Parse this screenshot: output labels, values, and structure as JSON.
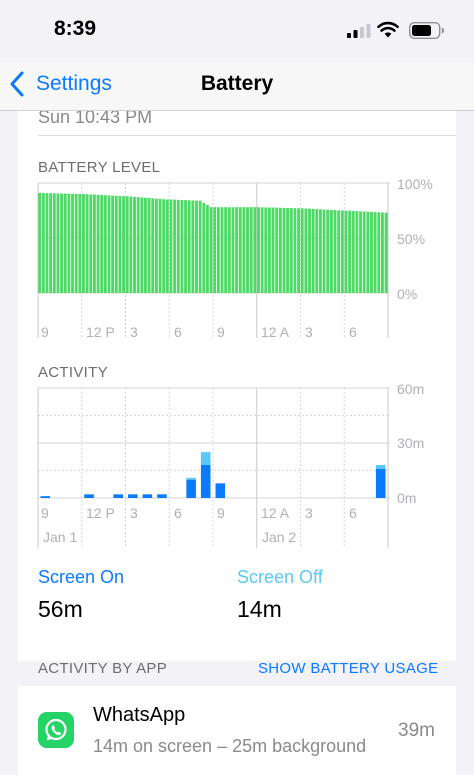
{
  "status_bar": {
    "time": "8:39"
  },
  "nav": {
    "back_label": "Settings",
    "title": "Battery"
  },
  "prev_date": "Sun 10:43 PM",
  "battery_level": {
    "label": "BATTERY LEVEL",
    "y_labels": [
      "100%",
      "50%",
      "0%"
    ],
    "x_labels": [
      "9",
      "12 P",
      "3",
      "6",
      "9",
      "12 A",
      "3",
      "6"
    ]
  },
  "activity": {
    "label": "ACTIVITY",
    "y_labels": [
      "60m",
      "30m",
      "0m"
    ],
    "x_labels": [
      "9",
      "12 P",
      "3",
      "6",
      "9",
      "12 A",
      "3",
      "6"
    ],
    "date_labels": [
      "Jan 1",
      "Jan 2"
    ]
  },
  "screen_on": {
    "label": "Screen On",
    "value": "56m"
  },
  "screen_off": {
    "label": "Screen Off",
    "value": "14m"
  },
  "activity_by_app": {
    "label": "ACTIVITY BY APP",
    "action": "SHOW BATTERY USAGE"
  },
  "apps": [
    {
      "name": "WhatsApp",
      "detail": "14m on screen – 25m background",
      "time": "39m",
      "icon": "whatsapp-icon"
    }
  ],
  "colors": {
    "battery": "#4cd964",
    "screen_on": "#0a7aff",
    "screen_off": "#5ac8fa",
    "accent": "#0a7aff"
  },
  "chart_data": [
    {
      "type": "bar",
      "title": "BATTERY LEVEL",
      "ylim": [
        0,
        100
      ],
      "yticks": [
        "100%",
        "50%",
        "0%"
      ],
      "xticks": [
        "9",
        "12 P",
        "3",
        "6",
        "9",
        "12 A",
        "3",
        "6"
      ],
      "segments": [
        {
          "hours": 3,
          "start": 91,
          "end": 90
        },
        {
          "hours": 3,
          "start": 90,
          "end": 88
        },
        {
          "hours": 3,
          "start": 88,
          "end": 85
        },
        {
          "hours": 2,
          "start": 85,
          "end": 84
        },
        {
          "hours": 1,
          "start": 84,
          "end": 78
        },
        {
          "hours": 3,
          "start": 78,
          "end": 78
        },
        {
          "hours": 3,
          "start": 78,
          "end": 77
        },
        {
          "hours": 3,
          "start": 77,
          "end": 75
        },
        {
          "hours": 3,
          "start": 75,
          "end": 73
        }
      ]
    },
    {
      "type": "bar",
      "title": "ACTIVITY",
      "ylim": [
        0,
        60
      ],
      "yticks": [
        "60m",
        "30m",
        "0m"
      ],
      "xticks": [
        "9",
        "12 P",
        "3",
        "6",
        "9",
        "12 A",
        "3",
        "6"
      ],
      "hours": [
        {
          "hour": 0,
          "on": 1,
          "off": 0
        },
        {
          "hour": 3,
          "on": 2,
          "off": 0
        },
        {
          "hour": 5,
          "on": 2,
          "off": 0
        },
        {
          "hour": 6,
          "on": 2,
          "off": 0
        },
        {
          "hour": 7,
          "on": 2,
          "off": 0
        },
        {
          "hour": 8,
          "on": 2,
          "off": 0
        },
        {
          "hour": 10,
          "on": 10,
          "off": 1
        },
        {
          "hour": 11,
          "on": 18,
          "off": 7
        },
        {
          "hour": 12,
          "on": 8,
          "off": 0
        },
        {
          "hour": 23,
          "on": 16,
          "off": 2
        }
      ]
    }
  ]
}
